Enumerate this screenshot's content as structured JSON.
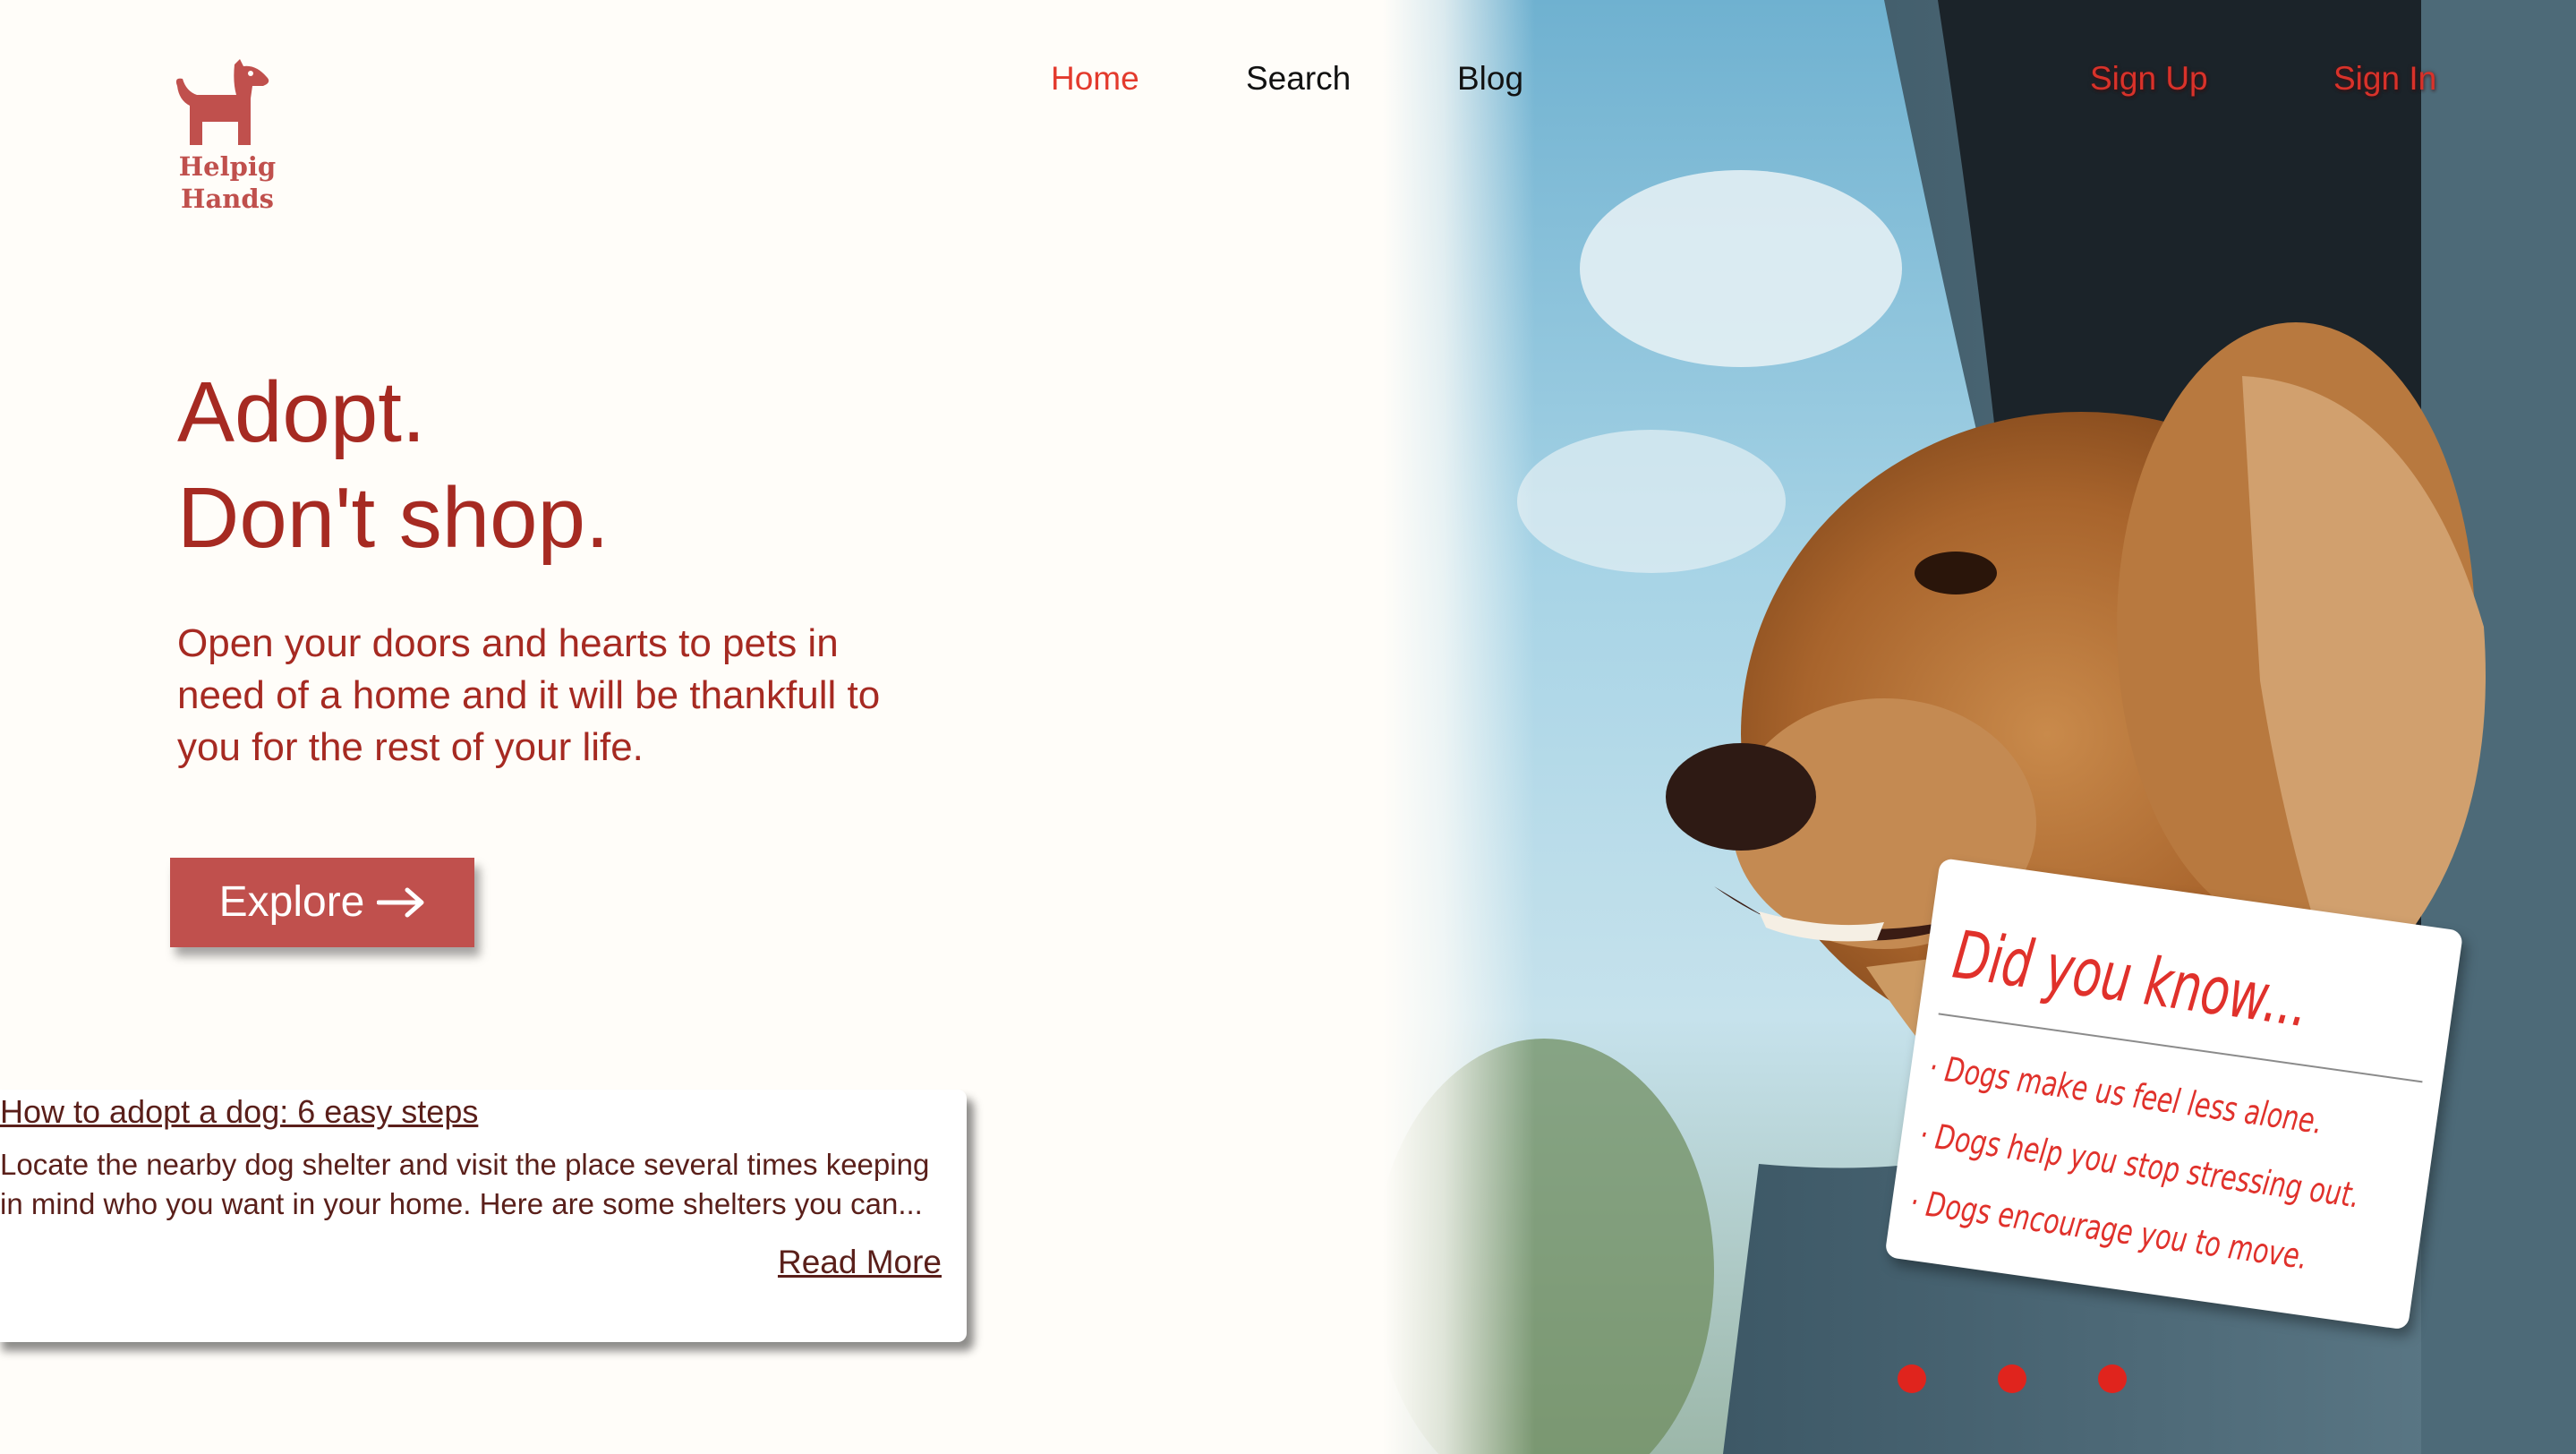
{
  "brand": {
    "name": "Helpig\nHands",
    "color": "#c0504d"
  },
  "nav": {
    "home": "Home",
    "search": "Search",
    "blog": "Blog",
    "sign_up": "Sign Up",
    "sign_in": "Sign In",
    "active_color": "#e33a2d"
  },
  "hero": {
    "headline_line1": "Adopt.",
    "headline_line2": "Don't shop.",
    "subtext": "Open your doors and hearts to pets in need of a home and it will be thankfull to you for the rest of your life.",
    "button_label": "Explore",
    "button_icon": "arrow-right-icon",
    "text_color": "#a62a22"
  },
  "blog_card": {
    "title": "How to adopt a dog: 6 easy steps",
    "excerpt": "Locate the nearby dog shelter and visit the place several times keeping in mind who you want in your home. Here are some shelters you can...",
    "read_more": "Read More"
  },
  "did_you_know": {
    "title": "Did you know...",
    "facts": [
      "· Dogs make us feel less alone.",
      "· Dogs help you stop stressing out.",
      "· Dogs encourage you to move."
    ],
    "text_color": "#e0312b"
  },
  "carousel": {
    "dot_count": 3,
    "dot_color": "#e0241d"
  }
}
